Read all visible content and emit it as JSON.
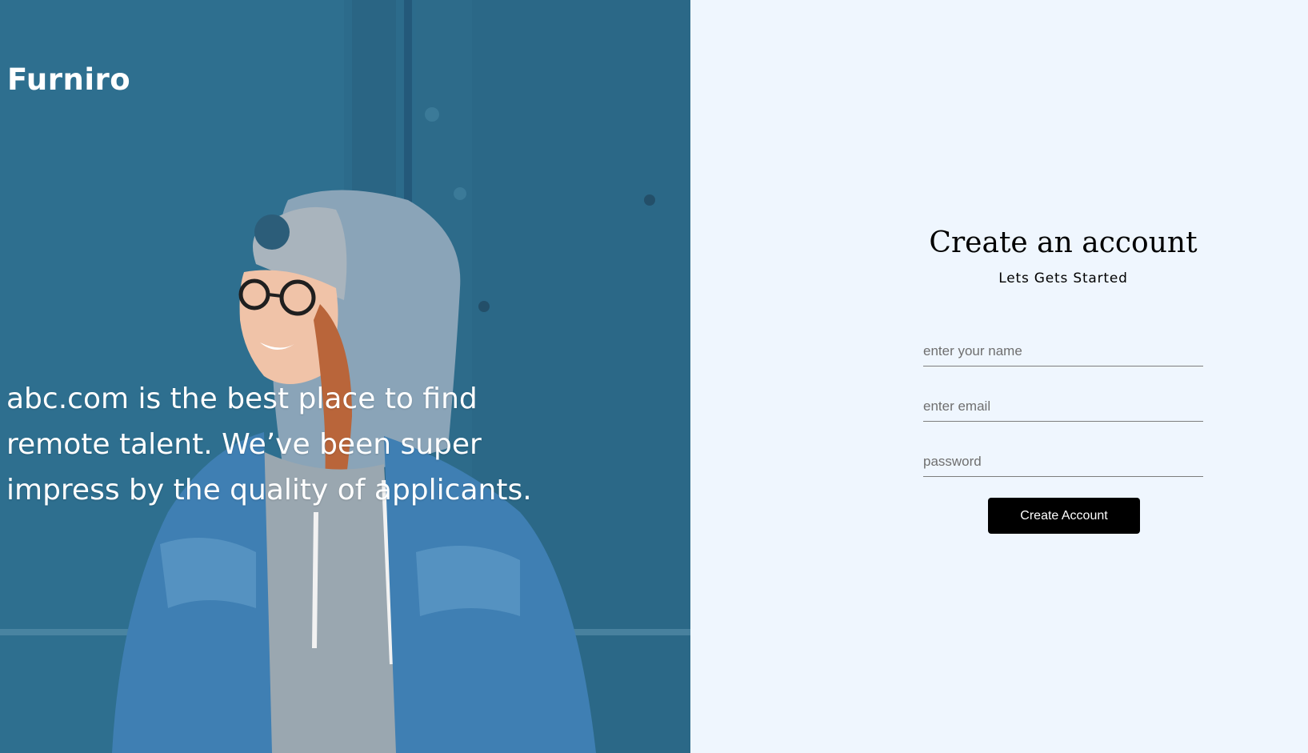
{
  "hero": {
    "brand": "Furniro",
    "tagline": "abc.com is the best place to find remote talent. We’ve been super impress by the quality of applicants.",
    "colors": {
      "wall": "#2b6886",
      "text": "#ffffff"
    }
  },
  "form": {
    "title": "Create an account",
    "subtitle": "Lets Gets Started",
    "name_placeholder": "enter your name",
    "email_placeholder": "enter email",
    "password_placeholder": "password",
    "submit_label": "Create Account",
    "colors": {
      "background": "#eff6fe",
      "button": "#000000",
      "button_text": "#ffffff"
    }
  }
}
